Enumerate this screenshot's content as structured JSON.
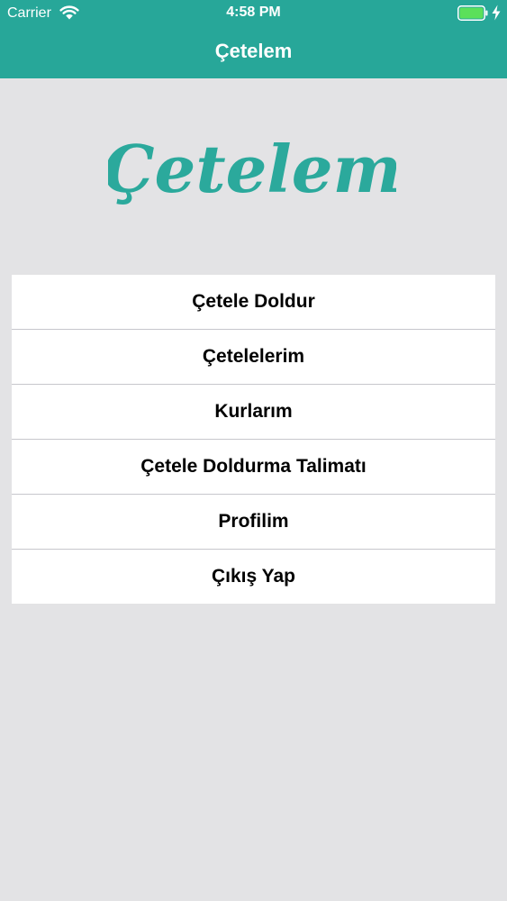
{
  "status_bar": {
    "carrier": "Carrier",
    "time": "4:58 PM",
    "wifi_icon": "wifi-icon",
    "battery_icon": "battery-full-icon",
    "charging_icon": "lightning-bolt-icon",
    "battery_color": "#5be05a"
  },
  "nav_bar": {
    "title": "Çetelem",
    "background_color": "#27a799"
  },
  "logo": {
    "text": "Çetelem",
    "color": "#2ba99c"
  },
  "menu": {
    "items": [
      {
        "label": "Çetele Doldur"
      },
      {
        "label": "Çetelelerim"
      },
      {
        "label": "Kurlarım"
      },
      {
        "label": "Çetele Doldurma Talimatı"
      },
      {
        "label": "Profilim"
      },
      {
        "label": "Çıkış Yap"
      }
    ]
  },
  "colors": {
    "page_background": "#e3e3e5",
    "separator": "#c7c7cc"
  }
}
